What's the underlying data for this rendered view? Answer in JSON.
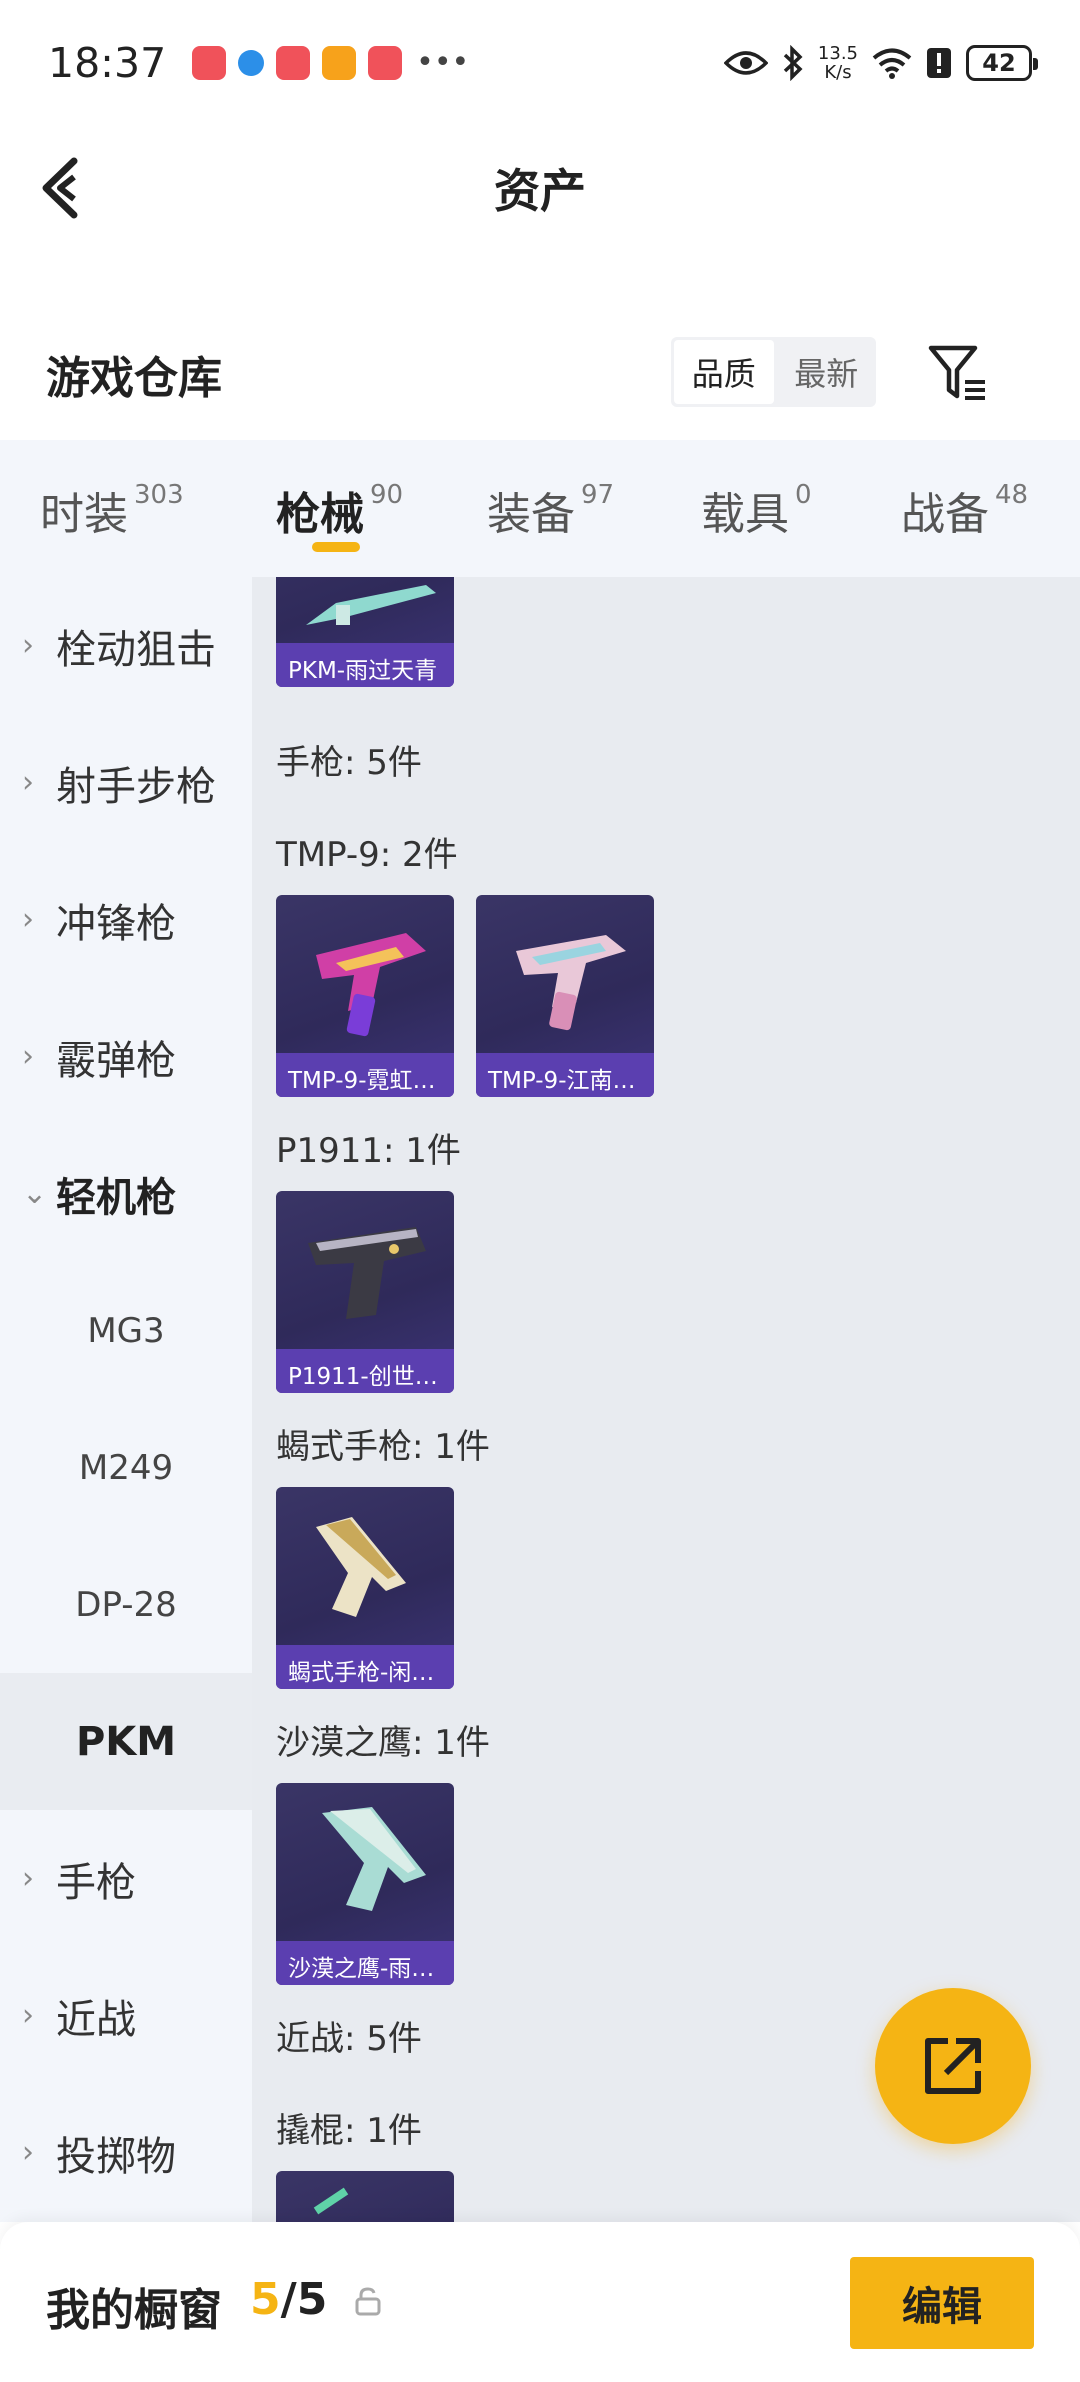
{
  "status_bar": {
    "time": "18:37",
    "net_speed_value": "13.5",
    "net_speed_unit": "K/s",
    "battery": "42"
  },
  "header": {
    "title": "资产"
  },
  "warehouse": {
    "title": "游戏仓库",
    "sort_options": [
      "品质",
      "最新"
    ],
    "active_sort": "品质"
  },
  "tabs": [
    {
      "label": "时装",
      "count": "303"
    },
    {
      "label": "枪械",
      "count": "90"
    },
    {
      "label": "装备",
      "count": "97"
    },
    {
      "label": "载具",
      "count": "0"
    },
    {
      "label": "战备",
      "count": "48"
    }
  ],
  "active_tab": "枪械",
  "sidebar": {
    "items": [
      {
        "label": "栓动狙击"
      },
      {
        "label": "射手步枪"
      },
      {
        "label": "冲锋枪"
      },
      {
        "label": "霰弹枪"
      },
      {
        "label": "轻机枪"
      },
      {
        "label": "MG3"
      },
      {
        "label": "M249"
      },
      {
        "label": "DP-28"
      },
      {
        "label": "PKM"
      },
      {
        "label": "手枪"
      },
      {
        "label": "近战"
      },
      {
        "label": "投掷物"
      }
    ],
    "expanded": "轻机枪",
    "selected": "PKM"
  },
  "content": {
    "top_card_name": "PKM-雨过天青",
    "sections": [
      {
        "title": "手枪: 5件"
      },
      {
        "title": "TMP-9: 2件",
        "cards": [
          "TMP-9-霓虹…",
          "TMP-9-江南…"
        ]
      },
      {
        "title": "P1911: 1件",
        "cards": [
          "P1911-创世…"
        ]
      },
      {
        "title": "蝎式手枪: 1件",
        "cards": [
          "蝎式手枪-闲…"
        ]
      },
      {
        "title": "沙漠之鹰: 1件",
        "cards": [
          "沙漠之鹰-雨…"
        ]
      },
      {
        "title": "近战: 5件"
      },
      {
        "title": "撬棍: 1件"
      }
    ]
  },
  "bottom_bar": {
    "showcase_label": "我的橱窗",
    "showcase_current": "5",
    "showcase_total": "/5",
    "edit_label": "编辑"
  },
  "colors": {
    "accent": "#f5b414",
    "card_label_bg": "#5b3fb0",
    "panel_bg": "#f3f6fb",
    "content_bg": "#e8ebf0"
  }
}
